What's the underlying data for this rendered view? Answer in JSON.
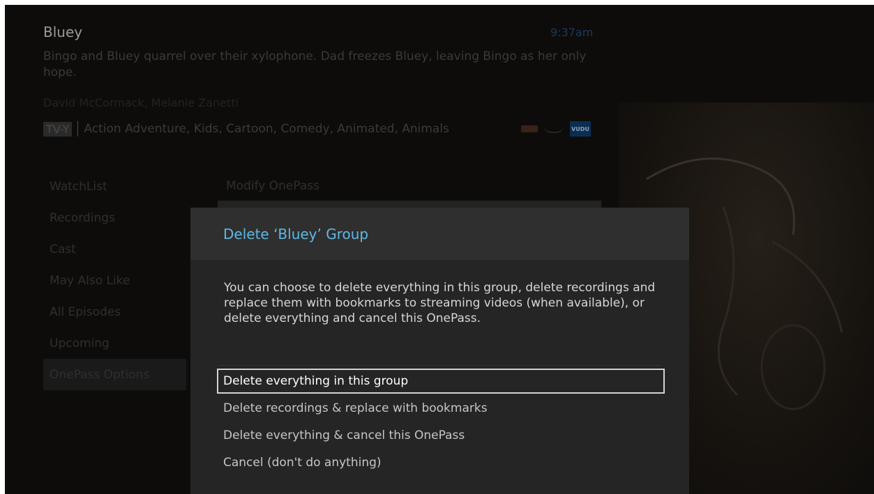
{
  "show": {
    "title": "Bluey",
    "clock": "9:37am",
    "description": "Bingo and Bluey quarrel over their xylophone. Dad freezes Bluey, leaving Bingo as her only hope.",
    "cast": "David McCormack, Melanie Zanetti",
    "rating": "TV-Y",
    "genres": "Action Adventure, Kids, Cartoon, Comedy, Animated, Animals",
    "provider_vudu_label": "VUDU"
  },
  "side_menu": {
    "items": [
      {
        "label": "WatchList"
      },
      {
        "label": "Recordings"
      },
      {
        "label": "Cast"
      },
      {
        "label": "May Also Like"
      },
      {
        "label": "All Episodes"
      },
      {
        "label": "Upcoming"
      },
      {
        "label": "OnePass Options"
      }
    ]
  },
  "options_menu": {
    "items": [
      {
        "label": "Modify OnePass"
      }
    ]
  },
  "dialog": {
    "title": "Delete ‘Bluey’ Group",
    "body": "You can choose to delete everything in this group, delete recordings and replace them with bookmarks to streaming videos (when available), or delete everything and cancel this OnePass.",
    "choices": [
      {
        "label": "Delete everything in this group"
      },
      {
        "label": "Delete recordings & replace with bookmarks"
      },
      {
        "label": "Delete everything & cancel this OnePass"
      },
      {
        "label": "Cancel (don't do anything)"
      }
    ]
  }
}
